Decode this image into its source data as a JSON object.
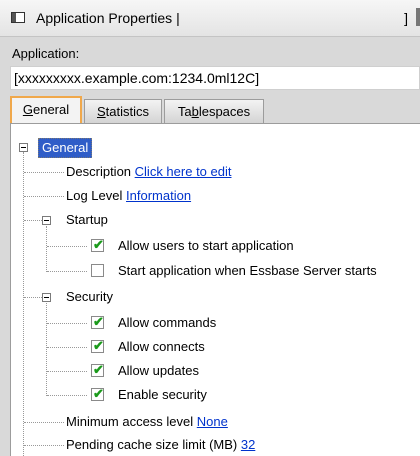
{
  "window": {
    "title": "Application Properties |",
    "end_mark": "]"
  },
  "application": {
    "label": "Application:",
    "value": "[xxxxxxxxx.example.com:1234.0ml12C]"
  },
  "tabs": [
    {
      "label": "General",
      "underline_index": 0,
      "active": true
    },
    {
      "label": "Statistics",
      "underline_index": 0,
      "active": false
    },
    {
      "label": "Tablespaces",
      "underline_index": 2,
      "active": false
    }
  ],
  "tree": {
    "root_label": "General",
    "description": {
      "label": "Description",
      "value": "Click here to edit "
    },
    "log_level": {
      "label": "Log Level",
      "value": "Information "
    },
    "startup": {
      "label": "Startup",
      "items": [
        {
          "label": "Allow users to start application",
          "checked": true
        },
        {
          "label": "Start application when Essbase Server starts",
          "checked": false
        }
      ]
    },
    "security": {
      "label": "Security",
      "items": [
        {
          "label": "Allow commands",
          "checked": true
        },
        {
          "label": "Allow connects",
          "checked": true
        },
        {
          "label": "Allow updates",
          "checked": true
        },
        {
          "label": "Enable security",
          "checked": true
        }
      ]
    },
    "min_access": {
      "label": "Minimum access level",
      "value": "None "
    },
    "pending_cache": {
      "label": "Pending cache size limit (MB)",
      "value": "32 "
    }
  },
  "colors": {
    "active_tab_border": "#f0a84b",
    "link": "#0033cc",
    "selection": "#2f5dc8",
    "checkmark": "#1b9a1b"
  },
  "icons": {
    "window": "window-icon",
    "expand_collapse": "collapse-toggle-icon",
    "checkbox": "checkbox-icon"
  }
}
